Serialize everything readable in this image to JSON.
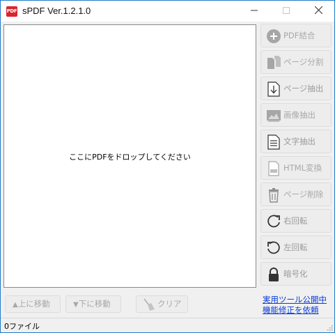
{
  "window": {
    "app_icon_text": "PDF",
    "title": "sPDF Ver.1.2.1.0",
    "minimize": "—",
    "maximize": "☐",
    "close": "✕"
  },
  "dropzone": {
    "hint": "ここにPDFをドロップしてください"
  },
  "side_buttons": [
    {
      "label": "PDF結合",
      "icon": "plus-circle-icon"
    },
    {
      "label": "ページ分割",
      "icon": "split-pages-icon"
    },
    {
      "label": "ページ抽出",
      "icon": "extract-page-icon"
    },
    {
      "label": "画像抽出",
      "icon": "image-icon"
    },
    {
      "label": "文字抽出",
      "icon": "text-document-icon"
    },
    {
      "label": "HTML変換",
      "icon": "html-file-icon"
    },
    {
      "label": "ページ削除",
      "icon": "trash-icon"
    },
    {
      "label": "右回転",
      "icon": "rotate-right-icon"
    },
    {
      "label": "左回転",
      "icon": "rotate-left-icon"
    },
    {
      "label": "暗号化",
      "icon": "lock-icon"
    }
  ],
  "bottom_buttons": {
    "move_up": "上に移動",
    "move_down": "下に移動",
    "clear": "クリア",
    "up_arrow": "▲",
    "down_arrow": "▼"
  },
  "links": {
    "tools": "実用ツール公開中",
    "request": "機能修正を依頼"
  },
  "status": {
    "file_count": "0ファイル"
  },
  "colors": {
    "title_border": "#1f7cc7",
    "app_icon": "#d7262d",
    "link": "#0a3cd8",
    "disabled_text": "#a8a8a8"
  }
}
